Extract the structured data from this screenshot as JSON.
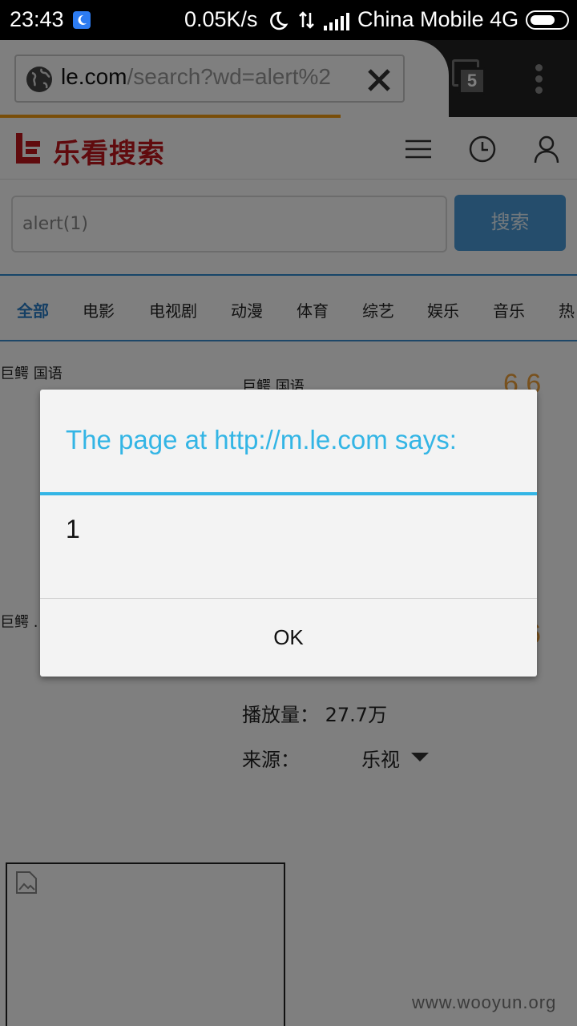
{
  "status_bar": {
    "time": "23:43",
    "net_speed": "0.05K/s",
    "carrier": "China Mobile 4G",
    "icons": [
      "moon-notification-icon",
      "moon-icon",
      "data-transfer-icon",
      "signal-icon",
      "battery-toggle-icon"
    ]
  },
  "browser": {
    "url_host": "le.com",
    "url_path": "/search?wd=alert%2",
    "tab_count": "5",
    "load_progress": 0.59,
    "icons": [
      "globe-icon",
      "clear-icon",
      "tabs-icon",
      "overflow-menu-icon"
    ]
  },
  "site": {
    "logo_text": "乐看搜索",
    "brand_color": "#c0171d",
    "icons": [
      "le-logo-icon",
      "hamburger-menu-icon",
      "history-clock-icon",
      "user-icon"
    ]
  },
  "search": {
    "value": "alert(1)",
    "button_label": "搜索"
  },
  "categories": [
    {
      "label": "全部",
      "active": true
    },
    {
      "label": "电影"
    },
    {
      "label": "电视剧"
    },
    {
      "label": "动漫"
    },
    {
      "label": "体育"
    },
    {
      "label": "综艺"
    },
    {
      "label": "娱乐"
    },
    {
      "label": "音乐"
    },
    {
      "label": "热"
    }
  ],
  "results": {
    "left_title_1": "巨鳄 国语",
    "right_title_1": "巨鳄 国语",
    "score_1": "6.6",
    "left_title_2": "巨鳄 .",
    "score_2": "6",
    "plays": "播放量：  27.7万",
    "source_label": "来源：",
    "source_value": "乐视"
  },
  "dialog": {
    "title": "The page at http://m.le.com says:",
    "message": "1",
    "ok_label": "OK",
    "accent": "#33b5e5"
  },
  "watermark": "www.wooyun.org"
}
